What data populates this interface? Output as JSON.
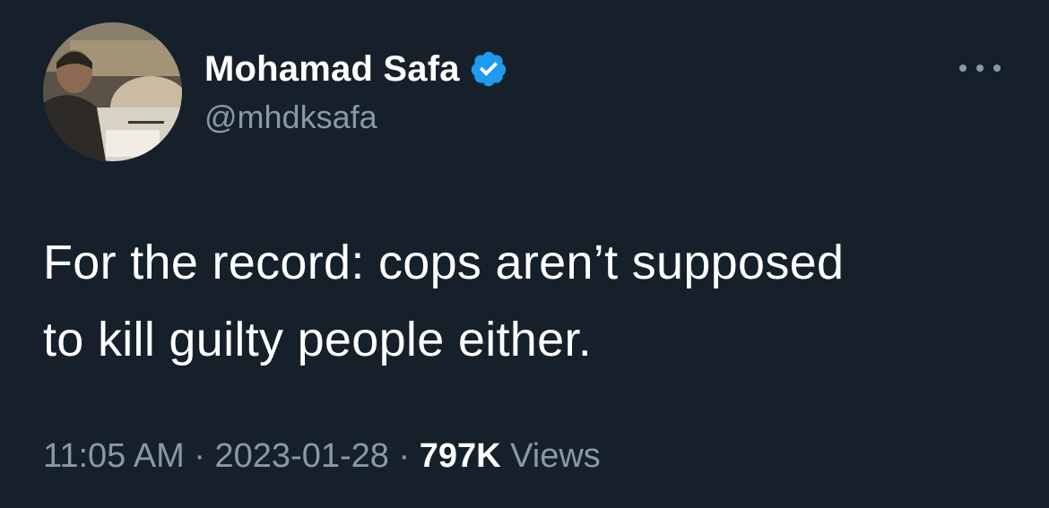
{
  "author": {
    "display_name": "Mohamad Safa",
    "handle": "@mhdksafa",
    "verified": true,
    "avatar_icon": "profile-photo"
  },
  "tweet": {
    "text_lines": [
      "For the record: cops aren’t supposed",
      "to kill guilty people either."
    ]
  },
  "meta": {
    "time": "11:05 AM",
    "separator": " · ",
    "date": "2023-01-28",
    "views_count": "797K",
    "views_label": "Views"
  },
  "colors": {
    "background": "#15202b",
    "secondary_text": "#8b98a5",
    "verified_badge": "#1d9bf0"
  },
  "icons": {
    "verified": "verified-badge-icon",
    "more": "more-options-icon"
  }
}
